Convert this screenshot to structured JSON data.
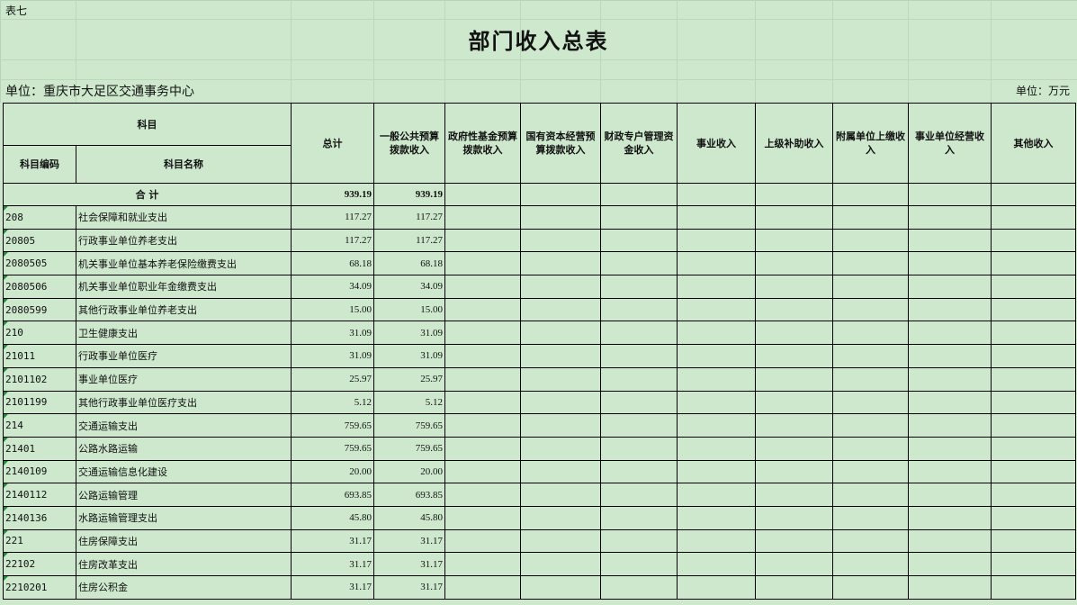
{
  "header": {
    "table_label": "表七",
    "title": "部门收入总表",
    "unit_left": "单位：重庆市大足区交通事务中心",
    "unit_right": "单位：万元"
  },
  "columns": {
    "subject": "科目",
    "subject_code": "科目编码",
    "subject_name": "科目名称",
    "total": "总计",
    "general_budget": "一般公共预算拨款收入",
    "gov_fund": "政府性基金预算拨款收入",
    "state_capital": "国有资本经营预算拨款收入",
    "fiscal_special": "财政专户管理资金收入",
    "business_income": "事业收入",
    "superior_subsidy": "上级补助收入",
    "affiliated_turnover": "附属单位上缴收入",
    "operating_income": "事业单位经营收入",
    "other_income": "其他收入"
  },
  "total_row": {
    "label": "合 计",
    "total": "939.19",
    "general_budget": "939.19"
  },
  "rows": [
    {
      "code": "208",
      "name": "社会保障和就业支出",
      "total": "117.27",
      "general_budget": "117.27"
    },
    {
      "code": "20805",
      "name": "行政事业单位养老支出",
      "total": "117.27",
      "general_budget": "117.27"
    },
    {
      "code": "2080505",
      "name": "机关事业单位基本养老保险缴费支出",
      "total": "68.18",
      "general_budget": "68.18"
    },
    {
      "code": "2080506",
      "name": "机关事业单位职业年金缴费支出",
      "total": "34.09",
      "general_budget": "34.09"
    },
    {
      "code": "2080599",
      "name": "其他行政事业单位养老支出",
      "total": "15.00",
      "general_budget": "15.00"
    },
    {
      "code": "210",
      "name": "卫生健康支出",
      "total": "31.09",
      "general_budget": "31.09"
    },
    {
      "code": "21011",
      "name": "行政事业单位医疗",
      "total": "31.09",
      "general_budget": "31.09"
    },
    {
      "code": "2101102",
      "name": "事业单位医疗",
      "total": "25.97",
      "general_budget": "25.97"
    },
    {
      "code": "2101199",
      "name": "其他行政事业单位医疗支出",
      "total": "5.12",
      "general_budget": "5.12"
    },
    {
      "code": "214",
      "name": "交通运输支出",
      "total": "759.65",
      "general_budget": "759.65"
    },
    {
      "code": "21401",
      "name": "公路水路运输",
      "total": "759.65",
      "general_budget": "759.65"
    },
    {
      "code": "2140109",
      "name": "交通运输信息化建设",
      "total": "20.00",
      "general_budget": "20.00"
    },
    {
      "code": "2140112",
      "name": "公路运输管理",
      "total": "693.85",
      "general_budget": "693.85"
    },
    {
      "code": "2140136",
      "name": "水路运输管理支出",
      "total": "45.80",
      "general_budget": "45.80"
    },
    {
      "code": "221",
      "name": "住房保障支出",
      "total": "31.17",
      "general_budget": "31.17"
    },
    {
      "code": "22102",
      "name": "住房改革支出",
      "total": "31.17",
      "general_budget": "31.17"
    },
    {
      "code": "2210201",
      "name": "住房公积金",
      "total": "31.17",
      "general_budget": "31.17"
    }
  ]
}
